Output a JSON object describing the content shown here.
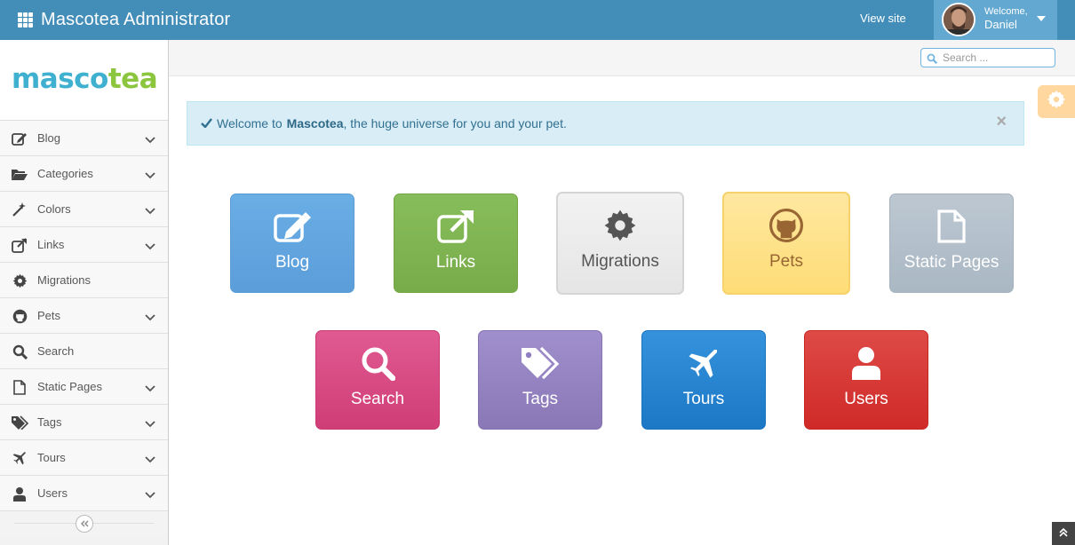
{
  "header": {
    "title": "Mascotea Administrator",
    "view_site": "View site",
    "welcome": "Welcome,",
    "user_name": "Daniel"
  },
  "logo": {
    "part1": "masco",
    "part2": "tea"
  },
  "sidebar": {
    "items": [
      {
        "label": "Blog",
        "icon": "edit-icon",
        "has_children": true
      },
      {
        "label": "Categories",
        "icon": "folder-open-icon",
        "has_children": true
      },
      {
        "label": "Colors",
        "icon": "magic-wand-icon",
        "has_children": true
      },
      {
        "label": "Links",
        "icon": "external-link-icon",
        "has_children": true
      },
      {
        "label": "Migrations",
        "icon": "gear-icon",
        "has_children": false
      },
      {
        "label": "Pets",
        "icon": "github-icon",
        "has_children": true
      },
      {
        "label": "Search",
        "icon": "search-icon",
        "has_children": false
      },
      {
        "label": "Static Pages",
        "icon": "file-icon",
        "has_children": true
      },
      {
        "label": "Tags",
        "icon": "tags-icon",
        "has_children": true
      },
      {
        "label": "Tours",
        "icon": "plane-icon",
        "has_children": true
      },
      {
        "label": "Users",
        "icon": "user-icon",
        "has_children": true
      }
    ]
  },
  "search": {
    "placeholder": "Search ..."
  },
  "alert": {
    "prefix": "Welcome to",
    "brand": "Mascotea",
    "suffix": ", the huge universe for you and your pet.",
    "close": "×"
  },
  "tiles": [
    {
      "label": "Blog",
      "icon": "edit-icon",
      "color": "#5ba4e0"
    },
    {
      "label": "Links",
      "icon": "external-link-icon",
      "color": "#7db04f"
    },
    {
      "label": "Migrations",
      "icon": "gear-icon",
      "color": "#e8e8e8"
    },
    {
      "label": "Pets",
      "icon": "github-icon",
      "color": "#ffe18a"
    },
    {
      "label": "Static Pages",
      "icon": "file-icon",
      "color": "#afbdc9"
    },
    {
      "label": "Search",
      "icon": "search-icon",
      "color": "#d64a83"
    },
    {
      "label": "Tags",
      "icon": "tags-icon",
      "color": "#9382c0"
    },
    {
      "label": "Tours",
      "icon": "plane-icon",
      "color": "#2585cf"
    },
    {
      "label": "Users",
      "icon": "user-icon",
      "color": "#d53434"
    }
  ],
  "colors": {
    "navbar": "#438eb9",
    "user_box": "#62a8d1",
    "settings": "#ffb752"
  }
}
